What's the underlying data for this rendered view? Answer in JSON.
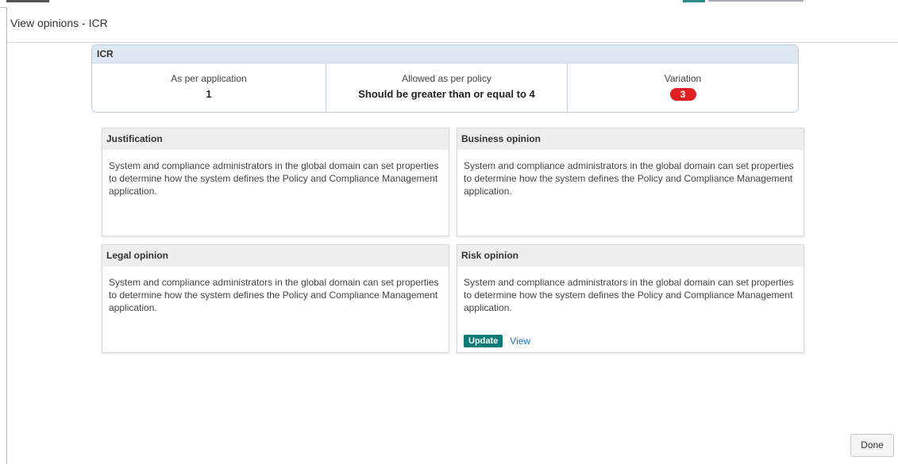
{
  "dialog": {
    "title": "View opinions - ICR"
  },
  "icr": {
    "title": "ICR",
    "application": {
      "label": "As per application",
      "value": "1"
    },
    "policy": {
      "label": "Allowed as per policy",
      "value": "Should be greater than or equal to 4"
    },
    "variation": {
      "label": "Variation",
      "value": "3",
      "badge_color": "#e02020"
    }
  },
  "cards": {
    "justification": {
      "title": "Justification",
      "text": "System and compliance administrators in the global domain can set properties to determine how the system defines the Policy and Compliance Management application."
    },
    "business": {
      "title": "Business opinion",
      "text": "System and compliance administrators in the global domain can set properties to determine how the system defines the Policy and Compliance Management application."
    },
    "legal": {
      "title": "Legal opinion",
      "text": "System and compliance administrators in the global domain can set properties to determine how the system defines the Policy and Compliance Management application."
    },
    "risk": {
      "title": "Risk opinion",
      "text": "System and compliance administrators in the global domain can set properties to determine how the system defines the Policy and Compliance Management application.",
      "update_label": "Update",
      "view_label": "View"
    }
  },
  "footer": {
    "done_label": "Done"
  },
  "colors": {
    "accent": "#0b7b77",
    "link": "#1a73c8",
    "header_blue": "#dde8f0"
  }
}
